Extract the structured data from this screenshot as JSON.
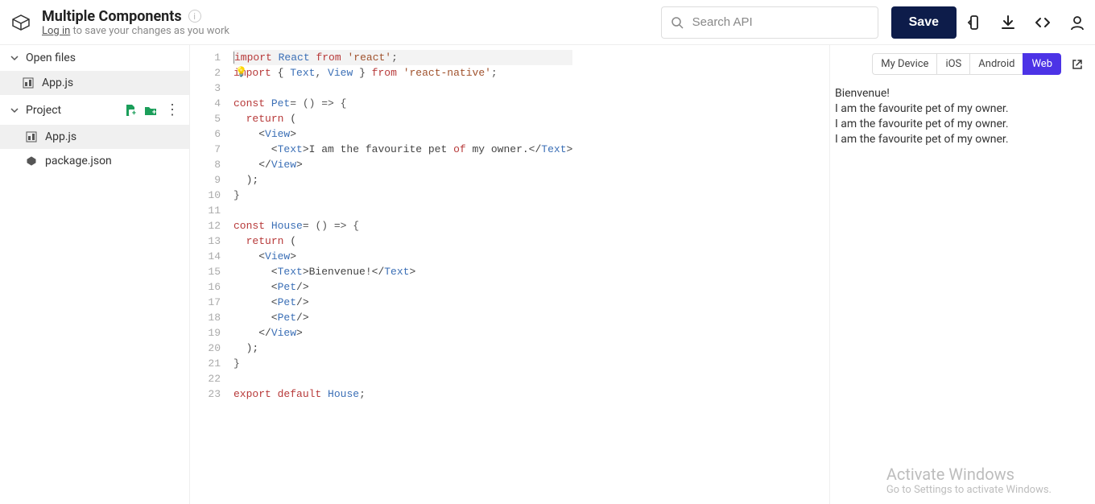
{
  "header": {
    "title": "Multiple Components",
    "login_text": "Log in",
    "subtitle_rest": " to save your changes as you work",
    "search_placeholder": "Search API",
    "save_label": "Save"
  },
  "sidebar": {
    "open_files_label": "Open files",
    "open_files": [
      {
        "name": "App.js"
      }
    ],
    "project_label": "Project",
    "project_files": [
      {
        "name": "App.js"
      },
      {
        "name": "package.json"
      }
    ]
  },
  "editor": {
    "line_count": 23,
    "lines": [
      [
        {
          "c": "tok-kw",
          "t": "import"
        },
        {
          "c": "tok-txt",
          "t": " "
        },
        {
          "c": "tok-id",
          "t": "React"
        },
        {
          "c": "tok-txt",
          "t": " "
        },
        {
          "c": "tok-kw",
          "t": "from"
        },
        {
          "c": "tok-txt",
          "t": " "
        },
        {
          "c": "tok-str",
          "t": "'react'"
        },
        {
          "c": "tok-punc",
          "t": ";"
        }
      ],
      [
        {
          "c": "tok-kw",
          "t": "import"
        },
        {
          "c": "tok-txt",
          "t": " { "
        },
        {
          "c": "tok-id",
          "t": "Text"
        },
        {
          "c": "tok-punc",
          "t": ", "
        },
        {
          "c": "tok-id",
          "t": "View"
        },
        {
          "c": "tok-txt",
          "t": " } "
        },
        {
          "c": "tok-kw",
          "t": "from"
        },
        {
          "c": "tok-txt",
          "t": " "
        },
        {
          "c": "tok-str",
          "t": "'react-native'"
        },
        {
          "c": "tok-punc",
          "t": ";"
        }
      ],
      [],
      [
        {
          "c": "tok-kw",
          "t": "const"
        },
        {
          "c": "tok-txt",
          "t": " "
        },
        {
          "c": "tok-id",
          "t": "Pet"
        },
        {
          "c": "tok-punc",
          "t": "= () => {"
        }
      ],
      [
        {
          "c": "tok-txt",
          "t": "  "
        },
        {
          "c": "tok-kw",
          "t": "return"
        },
        {
          "c": "tok-txt",
          "t": " ("
        }
      ],
      [
        {
          "c": "tok-txt",
          "t": "    <"
        },
        {
          "c": "tok-id",
          "t": "View"
        },
        {
          "c": "tok-txt",
          "t": ">"
        }
      ],
      [
        {
          "c": "tok-txt",
          "t": "      <"
        },
        {
          "c": "tok-id",
          "t": "Text"
        },
        {
          "c": "tok-txt",
          "t": ">I am the favourite pet "
        },
        {
          "c": "tok-kw",
          "t": "of"
        },
        {
          "c": "tok-txt",
          "t": " my owner.</"
        },
        {
          "c": "tok-id",
          "t": "Text"
        },
        {
          "c": "tok-txt",
          "t": ">"
        }
      ],
      [
        {
          "c": "tok-txt",
          "t": "    </"
        },
        {
          "c": "tok-id",
          "t": "View"
        },
        {
          "c": "tok-txt",
          "t": ">"
        }
      ],
      [
        {
          "c": "tok-txt",
          "t": "  );"
        }
      ],
      [
        {
          "c": "tok-punc",
          "t": "}"
        }
      ],
      [],
      [
        {
          "c": "tok-kw",
          "t": "const"
        },
        {
          "c": "tok-txt",
          "t": " "
        },
        {
          "c": "tok-id",
          "t": "House"
        },
        {
          "c": "tok-punc",
          "t": "= () => {"
        }
      ],
      [
        {
          "c": "tok-txt",
          "t": "  "
        },
        {
          "c": "tok-kw",
          "t": "return"
        },
        {
          "c": "tok-txt",
          "t": " ("
        }
      ],
      [
        {
          "c": "tok-txt",
          "t": "    <"
        },
        {
          "c": "tok-id",
          "t": "View"
        },
        {
          "c": "tok-txt",
          "t": ">"
        }
      ],
      [
        {
          "c": "tok-txt",
          "t": "      <"
        },
        {
          "c": "tok-id",
          "t": "Text"
        },
        {
          "c": "tok-txt",
          "t": ">Bienvenue!</"
        },
        {
          "c": "tok-id",
          "t": "Text"
        },
        {
          "c": "tok-txt",
          "t": ">"
        }
      ],
      [
        {
          "c": "tok-txt",
          "t": "      <"
        },
        {
          "c": "tok-id",
          "t": "Pet"
        },
        {
          "c": "tok-txt",
          "t": "/>"
        }
      ],
      [
        {
          "c": "tok-txt",
          "t": "      <"
        },
        {
          "c": "tok-id",
          "t": "Pet"
        },
        {
          "c": "tok-txt",
          "t": "/>"
        }
      ],
      [
        {
          "c": "tok-txt",
          "t": "      <"
        },
        {
          "c": "tok-id",
          "t": "Pet"
        },
        {
          "c": "tok-txt",
          "t": "/>"
        }
      ],
      [
        {
          "c": "tok-txt",
          "t": "    </"
        },
        {
          "c": "tok-id",
          "t": "View"
        },
        {
          "c": "tok-txt",
          "t": ">"
        }
      ],
      [
        {
          "c": "tok-txt",
          "t": "  );"
        }
      ],
      [
        {
          "c": "tok-punc",
          "t": "}"
        }
      ],
      [],
      [
        {
          "c": "tok-kw",
          "t": "export"
        },
        {
          "c": "tok-txt",
          "t": " "
        },
        {
          "c": "tok-kw",
          "t": "default"
        },
        {
          "c": "tok-txt",
          "t": " "
        },
        {
          "c": "tok-id",
          "t": "House"
        },
        {
          "c": "tok-punc",
          "t": ";"
        }
      ]
    ]
  },
  "preview": {
    "tabs": [
      "My Device",
      "iOS",
      "Android",
      "Web"
    ],
    "active_tab": "Web",
    "output": [
      "Bienvenue!",
      "I am the favourite pet of my owner.",
      "I am the favourite pet of my owner.",
      "I am the favourite pet of my owner."
    ]
  },
  "watermark": {
    "line1": "Activate Windows",
    "line2": "Go to Settings to activate Windows."
  }
}
